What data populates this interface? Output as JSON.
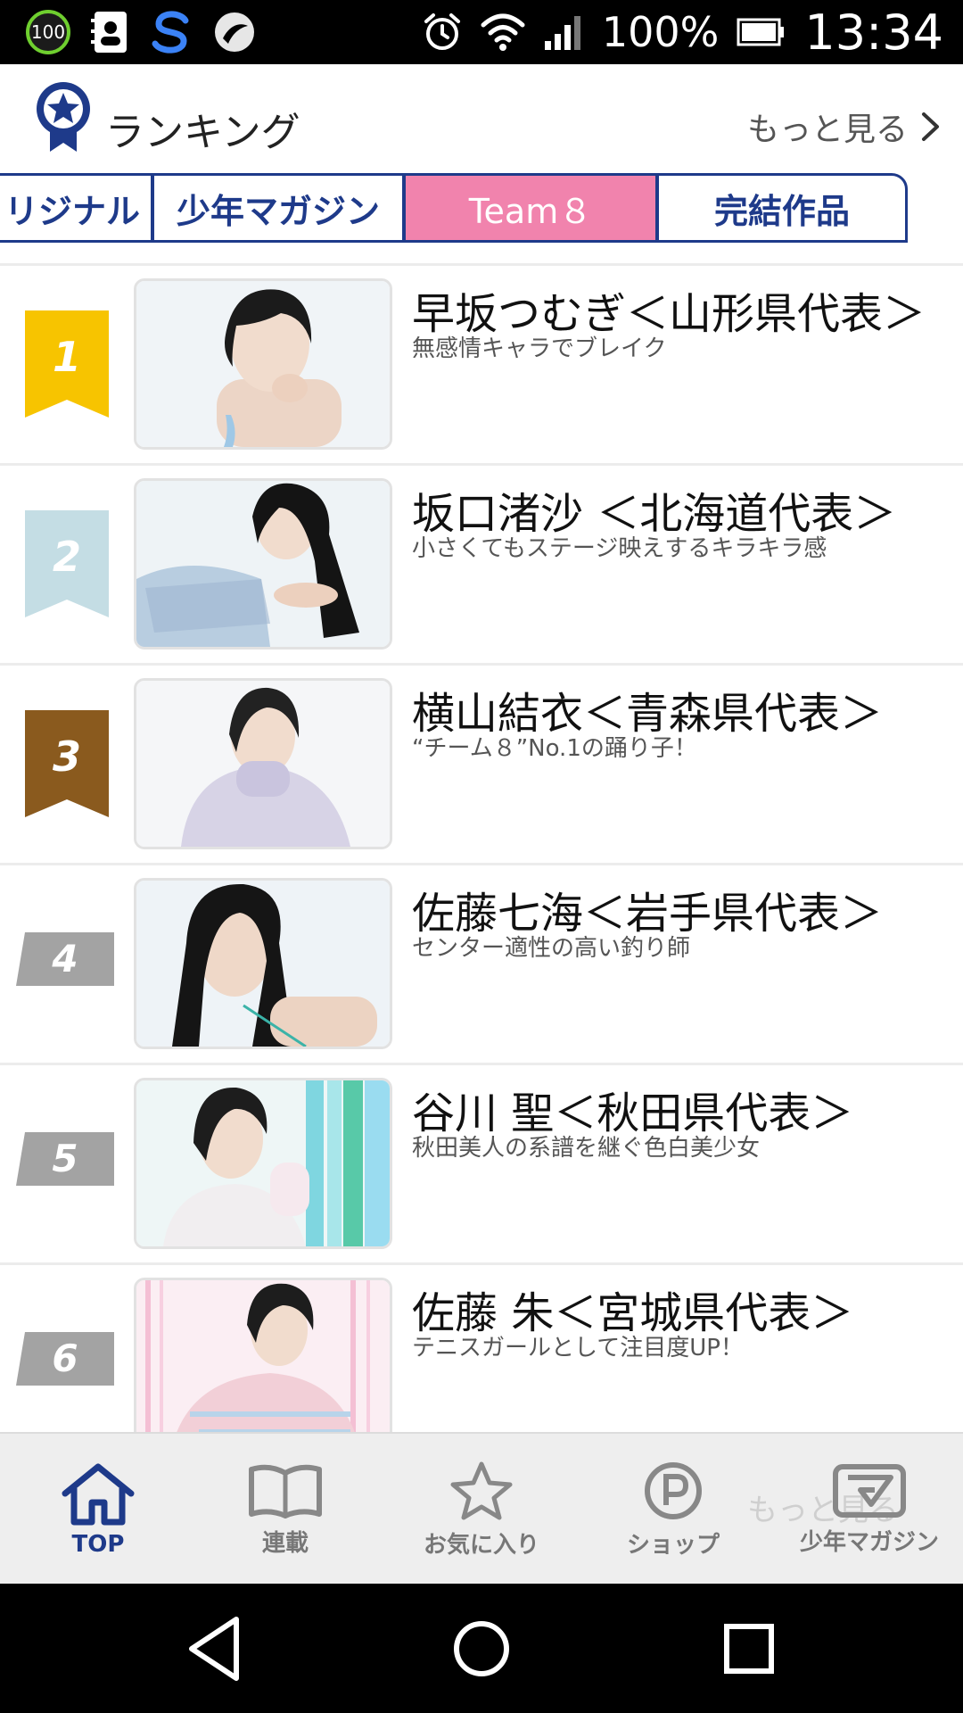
{
  "status_bar": {
    "badge_text": "100",
    "battery_text": "100%",
    "time": "13:34"
  },
  "header": {
    "title": "ランキング",
    "more_label": "もっと見る"
  },
  "tabs": [
    {
      "label": "リジナル",
      "active": false
    },
    {
      "label": "少年マガジン",
      "active": false
    },
    {
      "label": "Team８",
      "active": true
    },
    {
      "label": "完結作品",
      "active": false
    }
  ],
  "ranking": [
    {
      "rank": "1",
      "name": "早坂つむぎ＜山形県代表＞",
      "desc": "無感情キャラでブレイク",
      "badge_color": "#f7c400"
    },
    {
      "rank": "2",
      "name": "坂口渚沙 ＜北海道代表＞",
      "desc": "小さくてもステージ映えするキラキラ感",
      "badge_color": "#c4dde4"
    },
    {
      "rank": "3",
      "name": "横山結衣＜青森県代表＞",
      "desc": "“チーム８”No.1の踊り子！",
      "badge_color": "#8a5a1e"
    },
    {
      "rank": "4",
      "name": "佐藤七海＜岩手県代表＞",
      "desc": "センター適性の高い釣り師",
      "badge_color": "#a3a3a3"
    },
    {
      "rank": "5",
      "name": "谷川 聖＜秋田県代表＞",
      "desc": "秋田美人の系譜を継ぐ色白美少女",
      "badge_color": "#a3a3a3"
    },
    {
      "rank": "6",
      "name": "佐藤 朱＜宮城県代表＞",
      "desc": "テニスガールとして注目度UP！",
      "badge_color": "#a3a3a3"
    }
  ],
  "bottom_nav": {
    "items": [
      {
        "label": "TOP",
        "icon": "home-icon",
        "active": true
      },
      {
        "label": "連載",
        "icon": "book-icon",
        "active": false
      },
      {
        "label": "お気に入り",
        "icon": "star-icon",
        "active": false
      },
      {
        "label": "ショップ",
        "icon": "shop-icon",
        "active": false
      },
      {
        "label": "少年マガジン",
        "icon": "magazine-icon",
        "active": false
      }
    ],
    "ghost_text": "もっと見る"
  },
  "colors": {
    "accent": "#1e3a8a",
    "active_tab": "#f183ad"
  }
}
